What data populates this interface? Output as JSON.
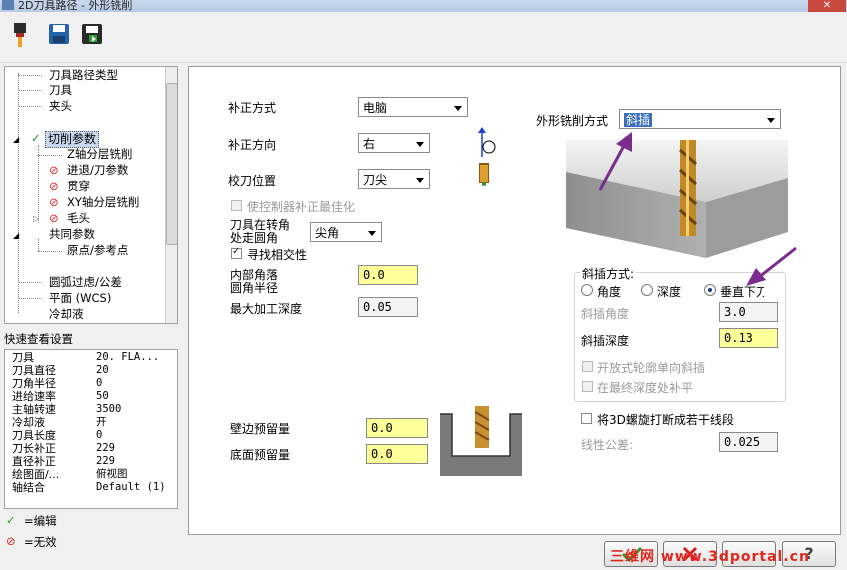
{
  "window": {
    "title": "2D刀具路径 - 外形铣削",
    "close_glyph": "✕"
  },
  "toolbar": {
    "icons": [
      "tool-icon",
      "save-icon",
      "export-icon"
    ]
  },
  "tree": {
    "items": [
      {
        "label": "刀具路径类型",
        "marker": ""
      },
      {
        "label": "刀具",
        "marker": ""
      },
      {
        "label": "夹头",
        "marker": ""
      },
      {
        "label": "切削参数",
        "marker": "check",
        "selected": true
      },
      {
        "label": "Z轴分层铣削",
        "marker": ""
      },
      {
        "label": "进退/刀参数",
        "marker": "invalid"
      },
      {
        "label": "贯穿",
        "marker": "invalid"
      },
      {
        "label": "XY轴分层铣削",
        "marker": "invalid"
      },
      {
        "label": "毛头",
        "marker": "invalid"
      },
      {
        "label": "共同参数",
        "marker": ""
      },
      {
        "label": "原点/参考点",
        "marker": ""
      },
      {
        "label": "圆弧过虑/公差",
        "marker": ""
      },
      {
        "label": "平面 (WCS)",
        "marker": ""
      },
      {
        "label": "冷却液",
        "marker": ""
      }
    ]
  },
  "quick_view": {
    "title": "快速查看设置",
    "rows": [
      {
        "k": "刀具",
        "v": "20. FLA..."
      },
      {
        "k": "刀具直径",
        "v": "20"
      },
      {
        "k": "刀角半径",
        "v": "0"
      },
      {
        "k": "进给速率",
        "v": "50"
      },
      {
        "k": "主轴转速",
        "v": "3500"
      },
      {
        "k": "冷却液",
        "v": "开"
      },
      {
        "k": "刀具长度",
        "v": "0"
      },
      {
        "k": "刀长补正",
        "v": "229"
      },
      {
        "k": "直径补正",
        "v": "229"
      },
      {
        "k": "绘图面/...",
        "v": "俯视图"
      },
      {
        "k": "轴结合",
        "v": "Default (1)"
      }
    ]
  },
  "legend": {
    "edit": "=编辑",
    "invalid": "=无效"
  },
  "form": {
    "comp_type": {
      "label": "补正方式",
      "value": "电脑"
    },
    "comp_dir": {
      "label": "补正方向",
      "value": "右"
    },
    "tip_comp": {
      "label": "校刀位置",
      "value": "刀尖"
    },
    "optimize": {
      "label": "使控制器补正最佳化",
      "checked": false,
      "disabled": true
    },
    "corner": {
      "label_line1": "刀具在转角",
      "label_line2": "处走圆角",
      "value": "尖角"
    },
    "infinite": {
      "label": "寻找相交性",
      "checked": true
    },
    "inner_corner": {
      "label_line1": "内部角落",
      "label_line2": "圆角半径",
      "value": "0.0"
    },
    "max_depth": {
      "label": "最大加工深度",
      "value": "0.05"
    },
    "wall_stock": {
      "label": "壁边预留量",
      "value": "0.0"
    },
    "floor_stock": {
      "label": "底面预留量",
      "value": "0.0"
    },
    "contour_type": {
      "label": "外形铣削方式",
      "value": "斜插"
    },
    "ramp": {
      "title": "斜插方式:",
      "options": [
        "角度",
        "深度",
        "垂直下刀"
      ],
      "selected": 2,
      "angle": {
        "label": "斜插角度",
        "value": "3.0"
      },
      "depth": {
        "label": "斜插深度",
        "value": "0.13"
      },
      "open_one_way": {
        "label": "开放式轮廓单向斜插",
        "checked": false
      },
      "final_comp": {
        "label": "在最终深度处补平",
        "checked": false
      }
    },
    "helix_break": {
      "label": "将3D螺旋打断成若干线段",
      "checked": false
    },
    "linear_tol": {
      "label": "线性公差:",
      "value": "0.025"
    }
  },
  "watermark": {
    "text": "三维网 www.3dportal.cn"
  },
  "colors": {
    "highlight": "#ffff99",
    "arrow": "#7b2d8e",
    "check": "#2e9a2e",
    "invalid": "#d42020"
  }
}
